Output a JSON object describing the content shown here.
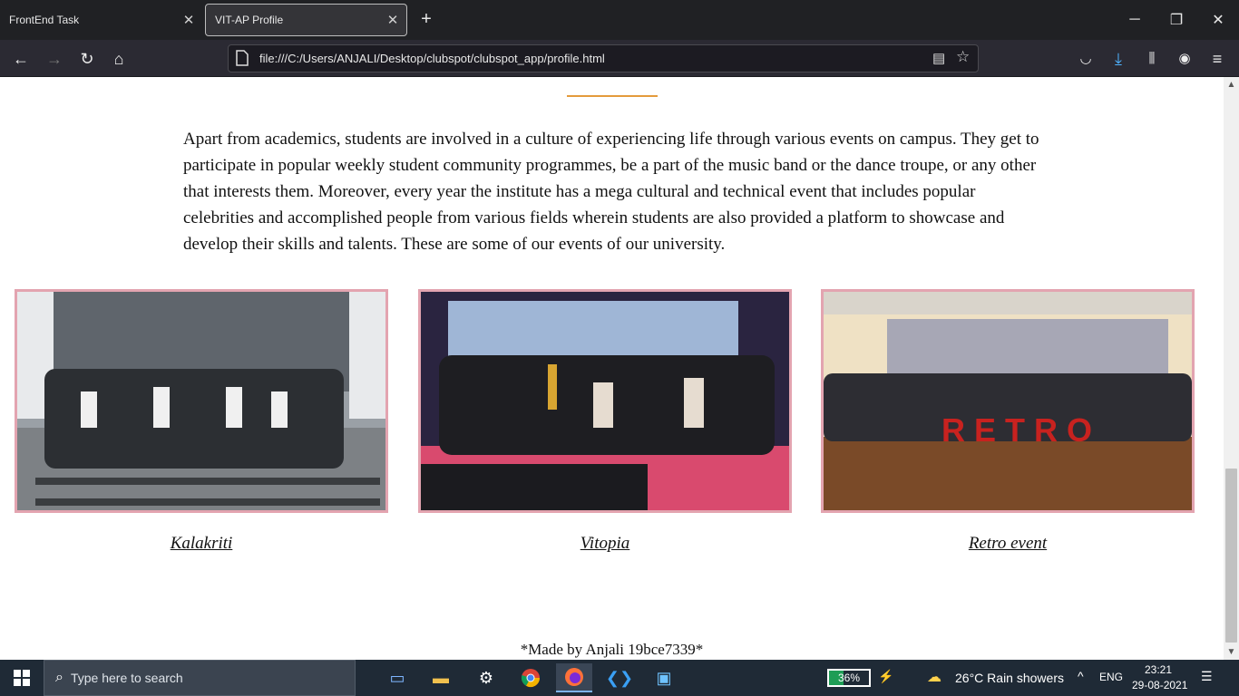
{
  "browser": {
    "tabs": [
      {
        "title": "FrontEnd Task"
      },
      {
        "title": "VIT-AP Profile"
      }
    ],
    "url": "file:///C:/Users/ANJALI/Desktop/clubspot/clubspot_app/profile.html"
  },
  "content": {
    "paragraph": "Apart from academics, students are involved in a culture of experiencing life through various events on campus. They get to participate in popular weekly student community programmes, be a part of the music band or the dance troupe, or any other that interests them. Moreover, every year the institute has a mega cultural and technical event that includes popular celebrities and accomplished people from various fields wherein students are also provided a platform to showcase and develop their skills and talents. These are some of our events of our university.",
    "events": [
      {
        "caption": "Kalakriti"
      },
      {
        "caption": "Vitopia"
      },
      {
        "caption": "Retro event"
      }
    ],
    "footer": "*Made by Anjali 19bce7339*",
    "accent_color": "#e49b3c",
    "frame_color": "#e3a4b0"
  },
  "taskbar": {
    "search_placeholder": "Type here to search",
    "battery_percent": "36%",
    "battery_level": 0.36,
    "weather": "26°C  Rain showers",
    "language": "ENG",
    "time": "23:21",
    "date": "29-08-2021"
  }
}
